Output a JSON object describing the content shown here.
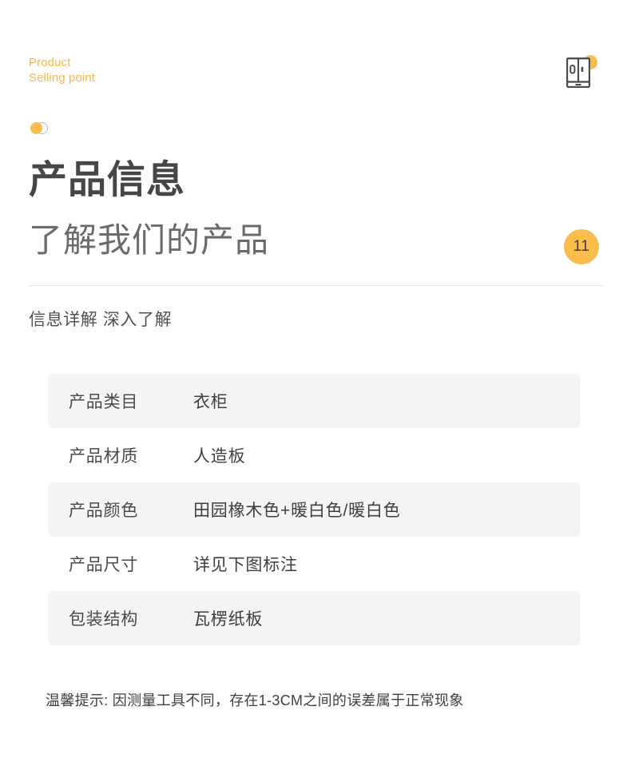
{
  "header": {
    "eyebrow_line1": "Product",
    "eyebrow_line2": "Selling point",
    "eyebrow_text": "Product\nSelling point",
    "wardrobe_icon": "wardrobe-icon",
    "accent_dot_icon": "dot-pair-icon"
  },
  "hero": {
    "title": "产品信息",
    "subtitle": "了解我们的产品",
    "badge_number": "11"
  },
  "section": {
    "caption": "信息详解 深入了解"
  },
  "spec_table": {
    "rows": [
      {
        "label": "产品类目",
        "value": "衣柜"
      },
      {
        "label": "产品材质",
        "value": "人造板"
      },
      {
        "label": "产品颜色",
        "value": "田园橡木色+暖白色/暖白色"
      },
      {
        "label": "产品尺寸",
        "value": "详见下图标注"
      },
      {
        "label": "包装结构",
        "value": "瓦楞纸板"
      }
    ]
  },
  "footnote": {
    "text": "温馨提示: 因测量工具不同，存在1-3CM之间的误差属于正常现象"
  },
  "colors": {
    "accent_orange": "#fabd4d",
    "eyebrow_orange": "#f7b64c",
    "row_shade": "#f4f4f5",
    "title_dark": "#464646",
    "subtitle_gray": "#6b6b6b",
    "divider_gray": "#e4e4e4"
  }
}
